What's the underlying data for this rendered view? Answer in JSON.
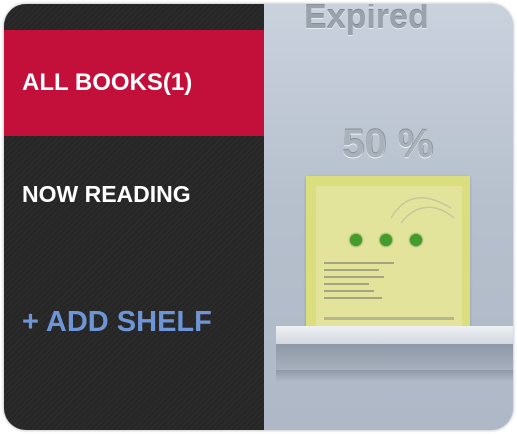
{
  "sidebar": {
    "items": [
      {
        "label": "ALL BOOKS(1)"
      },
      {
        "label": "NOW READING"
      },
      {
        "label": "+ ADD SHELF"
      }
    ]
  },
  "shelf": {
    "status": "Expired",
    "progress_text": "50 %",
    "progress": 0.5
  },
  "colors": {
    "accent": "#c3103a",
    "add_shelf": "#6e96d6",
    "sidebar_bg": "#262626",
    "book_cover": "#dde07a"
  },
  "icons": [
    "loading-dots-icon"
  ]
}
